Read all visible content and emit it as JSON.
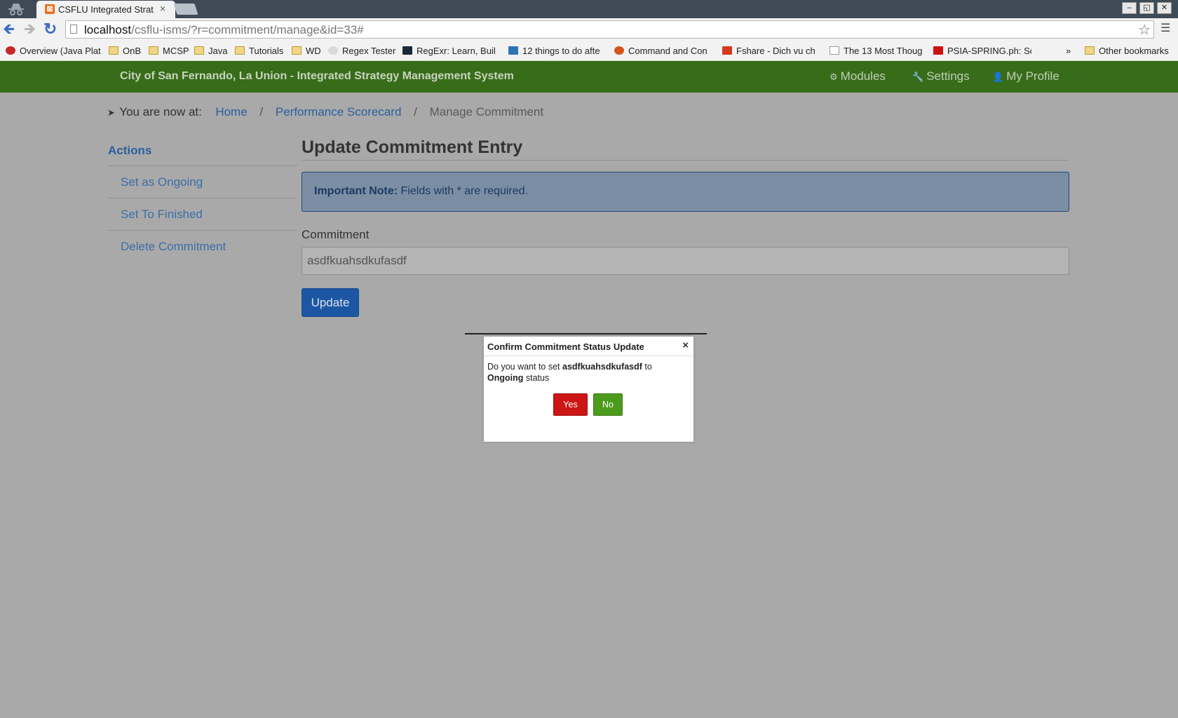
{
  "browser": {
    "tab_title": "CSFLU Integrated Strat",
    "tab_close": "×",
    "url_host": "localhost",
    "url_path": "/csflu-isms/?r=commitment/manage&id=33#",
    "window_buttons": [
      "–",
      "◱",
      "✕"
    ],
    "bookmarks_more": "»",
    "bookmarks": [
      {
        "label": "Overview (Java Plat",
        "icon": "oracle-icon",
        "color": "#c62828"
      },
      {
        "label": "OnB",
        "icon": "folder-icon"
      },
      {
        "label": "MCSP",
        "icon": "folder-icon"
      },
      {
        "label": "Java",
        "icon": "folder-icon"
      },
      {
        "label": "Tutorials",
        "icon": "folder-icon"
      },
      {
        "label": "WD",
        "icon": "folder-icon"
      },
      {
        "label": "Regex Tester",
        "icon": "regex-icon"
      },
      {
        "label": "RegExr: Learn, Buil",
        "icon": "regexr-icon",
        "color": "#1b2a3a"
      },
      {
        "label": "12 things to do afte",
        "icon": "wordpress-icon",
        "color": "#2e74b5"
      },
      {
        "label": "Command and Con",
        "icon": "firefox-icon",
        "color": "#d1541d"
      },
      {
        "label": "Fshare - Dich vu ch",
        "icon": "fshare-icon",
        "color": "#d33a1a"
      },
      {
        "label": "The 13 Most Thoug",
        "icon": "page-icon"
      },
      {
        "label": "PSIA-SPRING.ph: Sc",
        "icon": "youtube-icon",
        "color": "#d01010"
      },
      {
        "label": "Other bookmarks",
        "icon": "folder-icon"
      }
    ]
  },
  "app": {
    "title": "City of San Fernando, La Union - Integrated Strategy Management System",
    "nav": {
      "modules": "Modules",
      "settings": "Settings",
      "profile": "My Profile"
    },
    "nav_color": "#376c18"
  },
  "breadcrumb": {
    "label": "You are now at:",
    "home": "Home",
    "scorecard": "Performance Scorecard",
    "current": "Manage Commitment",
    "separator": "/"
  },
  "sidebar": {
    "title": "Actions",
    "items": [
      "Set as Ongoing",
      "Set To Finished",
      "Delete Commitment"
    ]
  },
  "main": {
    "title": "Update Commitment Entry",
    "note_label": "Important Note:",
    "note_text": " Fields with * are required.",
    "commitment_label": "Commitment",
    "commitment_value": "asdfkuahsdkufasdf",
    "update_button": "Update"
  },
  "dialog": {
    "title": "Confirm Commitment Status Update",
    "close": "×",
    "prefix": "Do you want to set ",
    "subject": "asdfkuahsdkufasdf",
    "middle": " to ",
    "status": "Ongoing",
    "suffix": " status",
    "yes": "Yes",
    "no": "No",
    "yes_color": "#cc1515",
    "no_color": "#4d9b1c"
  }
}
